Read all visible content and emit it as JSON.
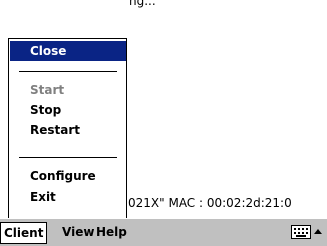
{
  "background": {
    "top_text": "ng...",
    "status_text": "021X\" MAC : 00:02:2d:21:0"
  },
  "menubar": {
    "items": [
      "Client",
      "View",
      "Help"
    ]
  },
  "client_menu": {
    "items": [
      {
        "label": "Close",
        "state": "highlighted"
      },
      {
        "label": "Start",
        "state": "disabled"
      },
      {
        "label": "Stop",
        "state": "enabled"
      },
      {
        "label": "Restart",
        "state": "enabled"
      },
      {
        "label": "Configure",
        "state": "enabled"
      },
      {
        "label": "Exit",
        "state": "enabled"
      }
    ]
  },
  "icons": {
    "keyboard": "keyboard-icon",
    "sip_arrow": "up-arrow-icon"
  },
  "colors": {
    "highlight": "#0a2485",
    "disabled_text": "#808080",
    "menubar_bg": "#c0c0c0"
  }
}
